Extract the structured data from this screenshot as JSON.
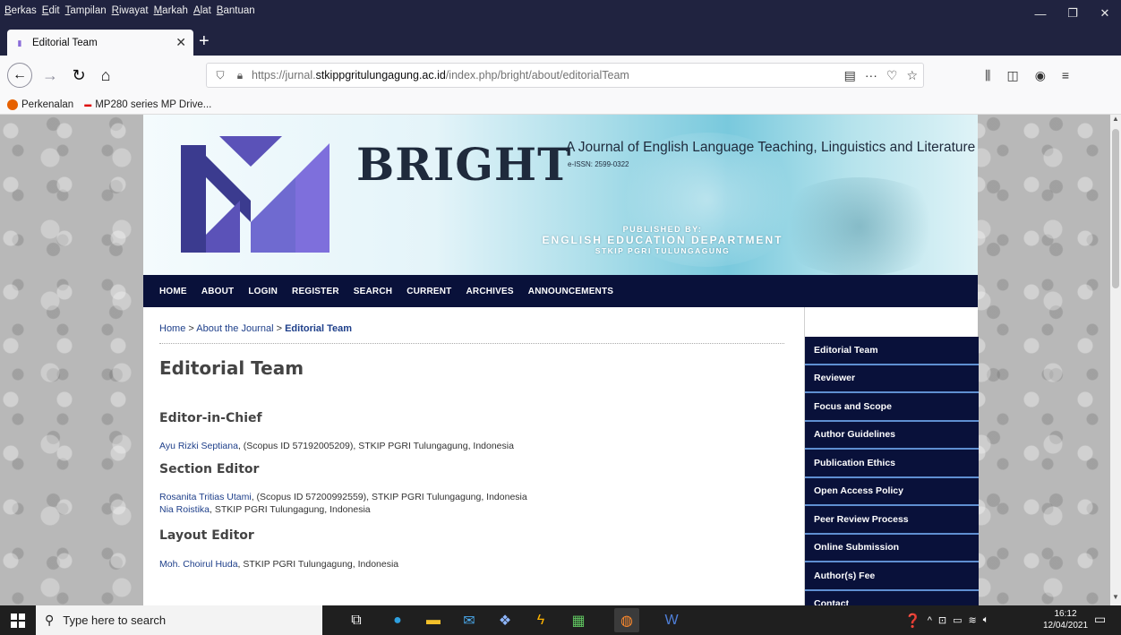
{
  "browser": {
    "menu": [
      "Berkas",
      "Edit",
      "Tampilan",
      "Riwayat",
      "Markah",
      "Alat",
      "Bantuan"
    ],
    "tab_title": "Editorial Team",
    "url_prefix": "https://jurnal.",
    "url_domain": "stkippgritulungagung.ac.id",
    "url_path": "/index.php/bright/about/editorialTeam",
    "bookmarks": [
      "Perkenalan",
      "MP280 series MP Drive..."
    ]
  },
  "banner": {
    "title": "BRIGHT",
    "subtitle": "A Journal of English Language Teaching, Linguistics and Literature",
    "issn": "e-ISSN: 2599-0322",
    "published_by": "PUBLISHED BY:",
    "department": "ENGLISH EDUCATION DEPARTMENT",
    "institution": "STKIP PGRI TULUNGAGUNG",
    "logo_colors": [
      "#3b3b8f",
      "#5b52b8",
      "#7e6fdc",
      "#6f8de2"
    ]
  },
  "nav": [
    "HOME",
    "ABOUT",
    "LOGIN",
    "REGISTER",
    "SEARCH",
    "CURRENT",
    "ARCHIVES",
    "ANNOUNCEMENTS"
  ],
  "breadcrumb": {
    "home": "Home",
    "sep": ">",
    "about": "About the Journal",
    "current": "Editorial Team"
  },
  "page_title": "Editorial Team",
  "sections": [
    {
      "title": "Editor-in-Chief",
      "members": [
        {
          "name": "Ayu Rizki Septiana",
          "info": ", (Scopus ID 57192005209), STKIP PGRI Tulungagung, Indonesia"
        }
      ]
    },
    {
      "title": "Section Editor",
      "members": [
        {
          "name": "Rosanita Tritias Utami",
          "info": ", (Scopus ID 57200992559), STKIP PGRI Tulungagung, Indonesia"
        },
        {
          "name": "Nia Roistika",
          "info": ", STKIP PGRI Tulungagung, Indonesia"
        }
      ]
    },
    {
      "title": "Layout Editor",
      "members": [
        {
          "name": "Moh. Choirul Huda",
          "info": ", STKIP PGRI Tulungagung, Indonesia"
        }
      ]
    }
  ],
  "sidebar": [
    "Editorial Team",
    "Reviewer",
    "Focus and Scope",
    "Author Guidelines",
    "Publication Ethics",
    "Open Access Policy",
    "Peer Review Process",
    "Online Submission",
    "Author(s) Fee",
    "Contact"
  ],
  "taskbar": {
    "search_placeholder": "Type here to search",
    "time": "16:12",
    "date": "12/04/2021"
  },
  "colors": {
    "nav_bg": "#09113a",
    "link": "#1e3f8a",
    "sidebar_border": "#5f8fd1"
  }
}
